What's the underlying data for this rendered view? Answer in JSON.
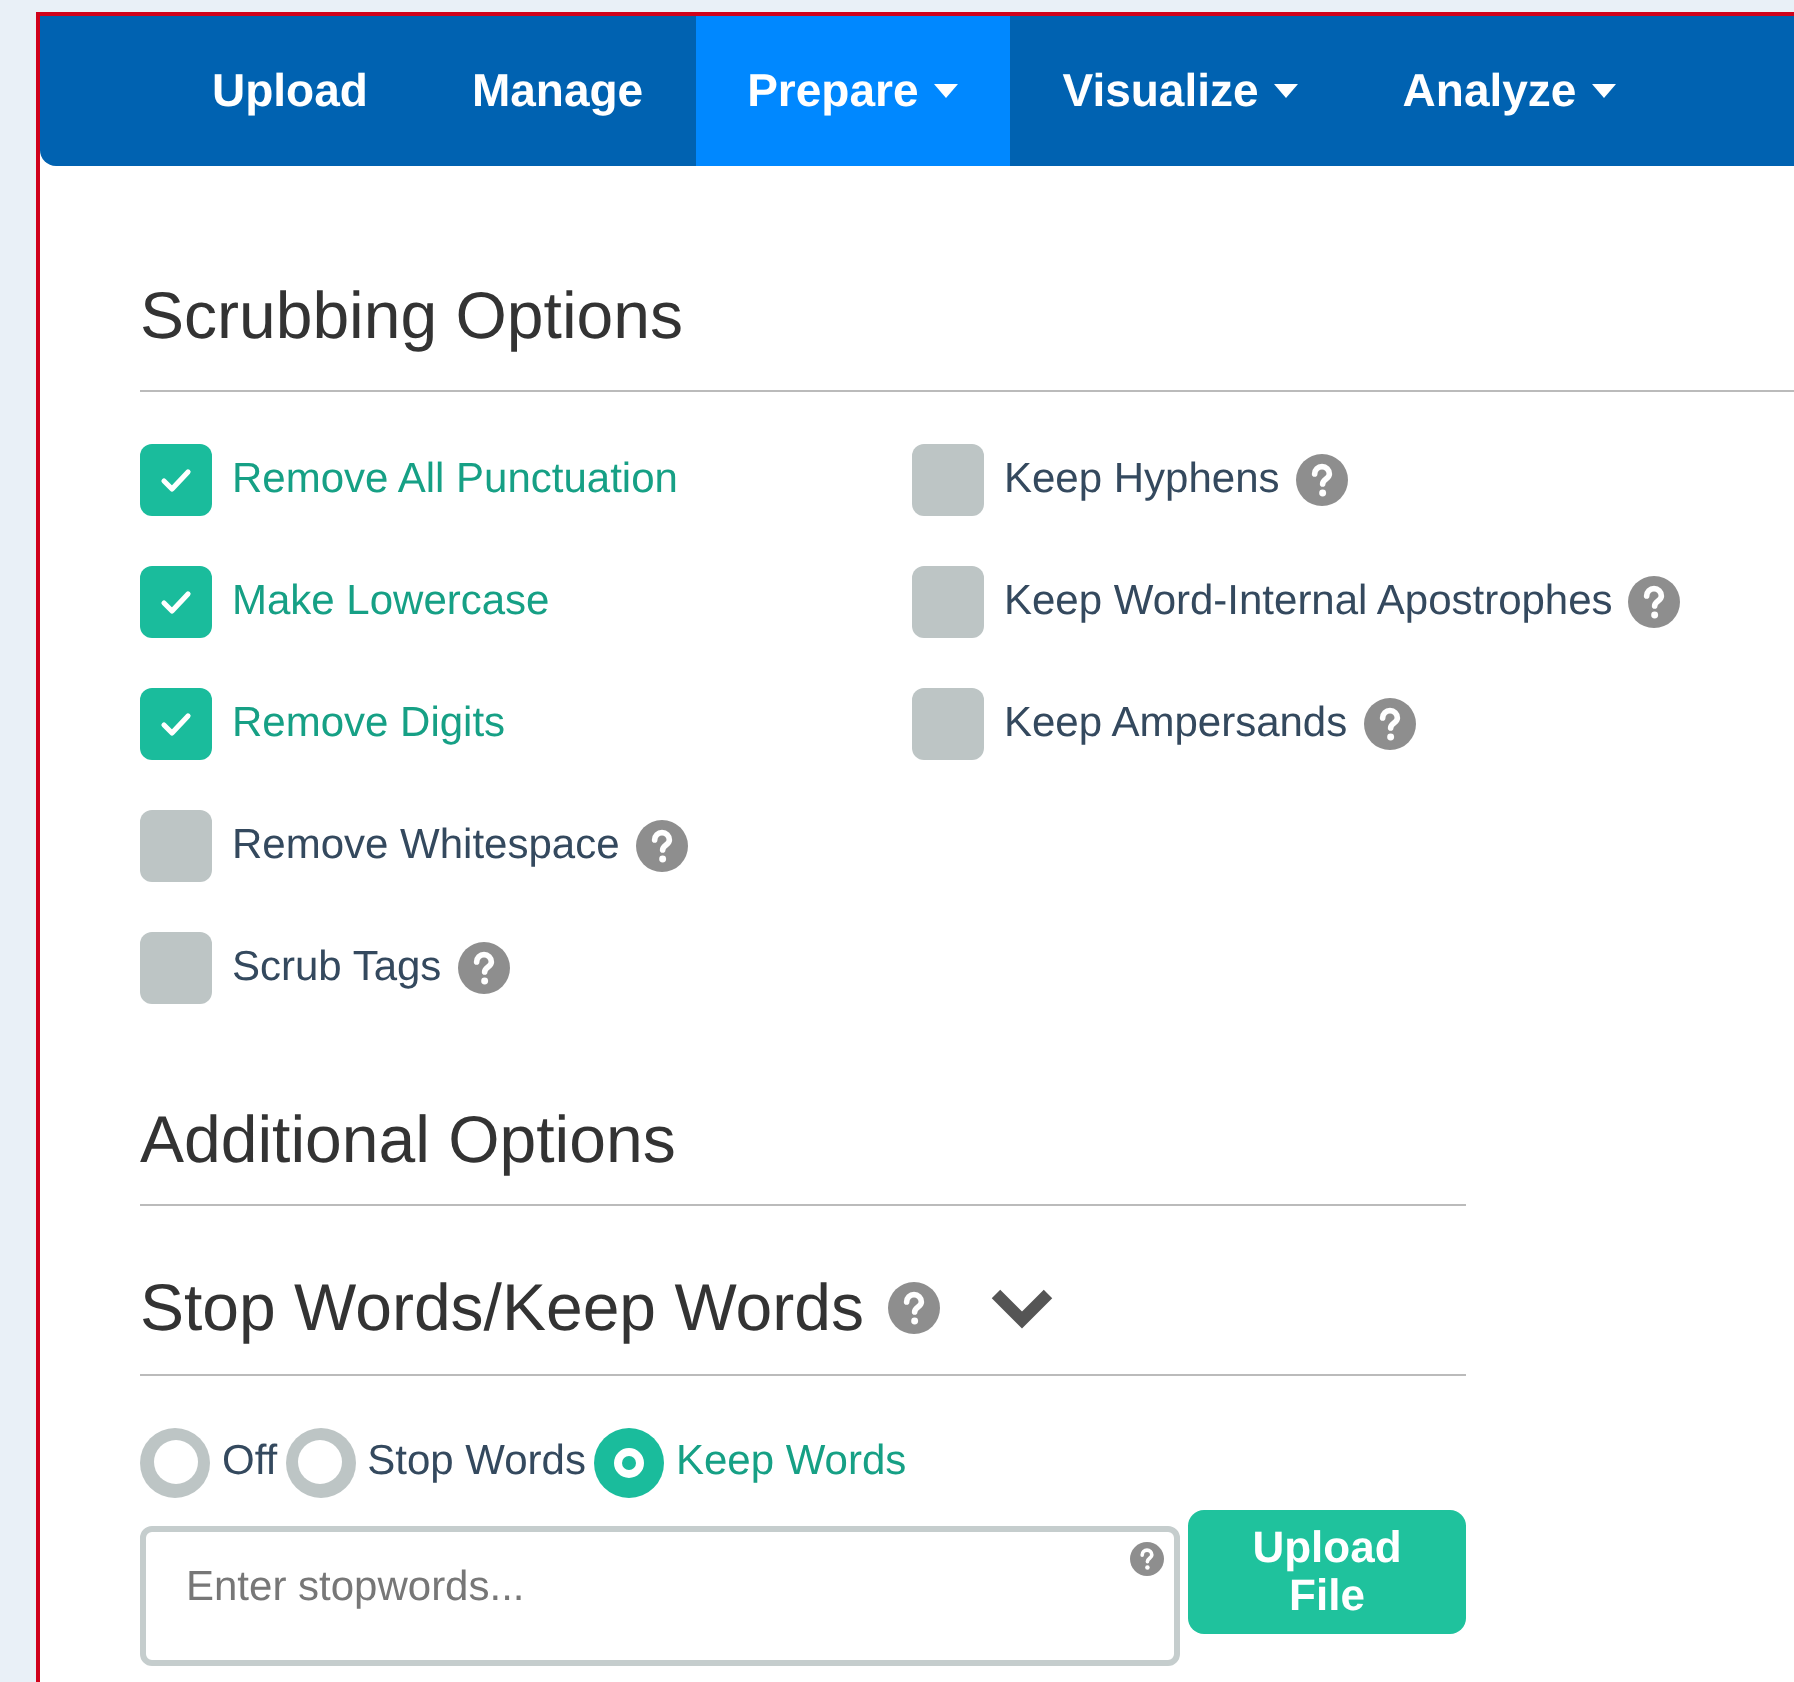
{
  "nav": {
    "items": [
      {
        "label": "Upload",
        "selected": false,
        "dropdown": false
      },
      {
        "label": "Manage",
        "selected": false,
        "dropdown": false
      },
      {
        "label": "Prepare",
        "selected": true,
        "dropdown": true
      },
      {
        "label": "Visualize",
        "selected": false,
        "dropdown": true
      },
      {
        "label": "Analyze",
        "selected": false,
        "dropdown": true
      }
    ]
  },
  "scrubbing": {
    "title": "Scrubbing Options",
    "left_options": [
      {
        "label": "Remove All Punctuation",
        "checked": true,
        "help": false
      },
      {
        "label": "Make Lowercase",
        "checked": true,
        "help": false
      },
      {
        "label": "Remove Digits",
        "checked": true,
        "help": false
      },
      {
        "label": "Remove Whitespace",
        "checked": false,
        "help": true
      },
      {
        "label": "Scrub Tags",
        "checked": false,
        "help": true
      }
    ],
    "right_options": [
      {
        "label": "Keep Hyphens",
        "checked": false,
        "help": true
      },
      {
        "label": "Keep Word-Internal Apostrophes",
        "checked": false,
        "help": true
      },
      {
        "label": "Keep Ampersands",
        "checked": false,
        "help": true
      }
    ]
  },
  "additional": {
    "title": "Additional Options"
  },
  "stop_words": {
    "title": "Stop Words/Keep Words",
    "expanded": true,
    "modes": [
      {
        "label": "Off",
        "selected": false
      },
      {
        "label": "Stop Words",
        "selected": false
      },
      {
        "label": "Keep Words",
        "selected": true
      }
    ],
    "input": {
      "placeholder": "Enter stopwords..."
    },
    "upload_button": "Upload File"
  }
}
